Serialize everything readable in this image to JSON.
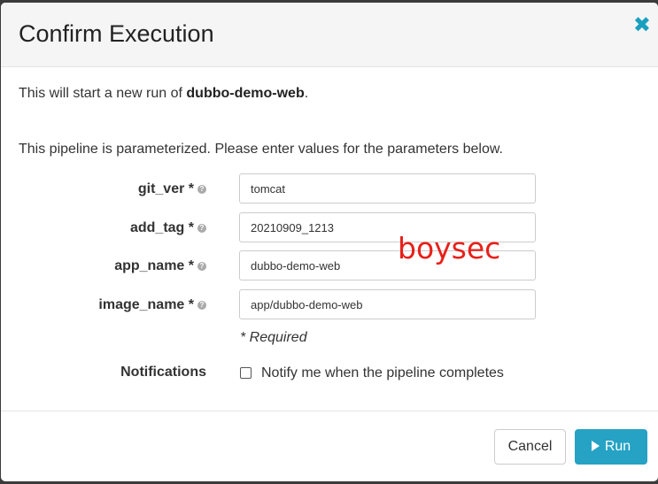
{
  "modal": {
    "title": "Confirm Execution",
    "close_glyph": "✖",
    "intro_prefix": "This will start a new run of ",
    "pipeline_name": "dubbo-demo-web",
    "intro_suffix": ".",
    "param_intro": "This pipeline is parameterized. Please enter values for the parameters below."
  },
  "params": [
    {
      "label": "git_ver *",
      "value": "tomcat"
    },
    {
      "label": "add_tag *",
      "value": "20210909_1213"
    },
    {
      "label": "app_name *",
      "value": "dubbo-demo-web"
    },
    {
      "label": "image_name *",
      "value": "app/dubbo-demo-web"
    }
  ],
  "help_glyph": "?",
  "required_note": "* Required",
  "notifications": {
    "label": "Notifications",
    "checkbox_text": "Notify me when the pipeline completes",
    "checked": false
  },
  "watermark": "boysec",
  "footer": {
    "cancel_label": "Cancel",
    "run_label": "Run"
  },
  "colors": {
    "accent": "#25a2c4",
    "close": "#1a9fbf",
    "watermark": "#e8201a"
  }
}
